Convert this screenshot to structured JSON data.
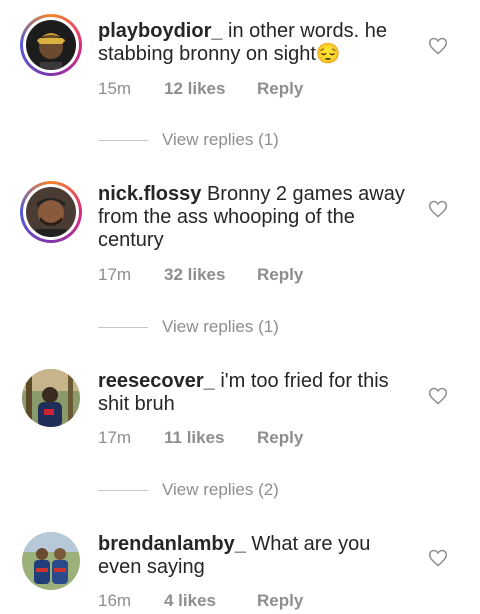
{
  "comments": [
    {
      "username": "playboydior_",
      "text": " in other words. he stabbing bronny on sight😔",
      "time": "15m",
      "likes": "12 likes",
      "reply_label": "Reply",
      "view_replies": "View replies (1)"
    },
    {
      "username": "nick.flossy",
      "text": " Bronny 2 games away from the ass whooping of the century",
      "time": "17m",
      "likes": "32 likes",
      "reply_label": "Reply",
      "view_replies": "View replies (1)"
    },
    {
      "username": "reesecover_",
      "text": " i'm too fried for this shit bruh",
      "time": "17m",
      "likes": "11 likes",
      "reply_label": "Reply",
      "view_replies": "View replies (2)"
    },
    {
      "username": "brendanlamby_",
      "text": " What are you even saying",
      "time": "16m",
      "likes": "4 likes",
      "reply_label": "Reply"
    }
  ],
  "colors": {
    "secondary_text": "#8e8e8e",
    "primary_text": "#262626"
  },
  "icons": {
    "like": "heart-outline-icon"
  }
}
